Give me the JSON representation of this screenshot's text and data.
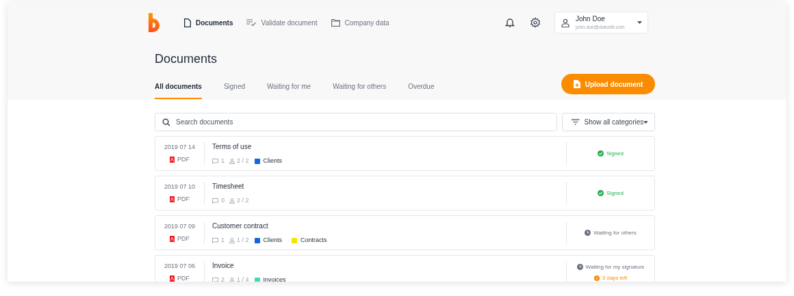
{
  "nav": {
    "items": [
      {
        "label": "Documents",
        "kind": "file",
        "selected": true
      },
      {
        "label": "Validate document",
        "kind": "checklist",
        "selected": false
      },
      {
        "label": "Company data",
        "kind": "folder",
        "selected": false
      }
    ]
  },
  "user": {
    "name": "John Doe",
    "email": "john.doe@dokobit.com"
  },
  "page_title": "Documents",
  "tabs": [
    {
      "label": "All documents",
      "selected": true
    },
    {
      "label": "Signed",
      "selected": false
    },
    {
      "label": "Waiting for me",
      "selected": false
    },
    {
      "label": "Waiting for others",
      "selected": false
    },
    {
      "label": "Overdue",
      "selected": false
    }
  ],
  "upload_button": "Upload document",
  "search": {
    "placeholder": "Search documents"
  },
  "filter": "Show all categories",
  "documents": [
    {
      "date": "2019 07 14",
      "type": "PDF",
      "title": "Terms of use",
      "comments": "1",
      "signers": "2 / 2",
      "tags": [
        {
          "label": "Clients",
          "color": "#1565e0"
        }
      ],
      "status": {
        "kind": "signed",
        "label": "Signed"
      }
    },
    {
      "date": "2019 07 10",
      "type": "PDF",
      "title": "Timesheet",
      "comments": "0",
      "signers": "2 / 2",
      "status": {
        "kind": "signed",
        "label": "Signed"
      }
    },
    {
      "date": "2019 07 09",
      "type": "PDF",
      "title": "Customer contract",
      "comments": "1",
      "signers": "1 / 2",
      "tags": [
        {
          "label": "Clients",
          "color": "#1565e0"
        },
        {
          "label": "Contracts",
          "color": "#f5e600"
        }
      ],
      "status": {
        "kind": "waiting",
        "label": "Waiting for others"
      }
    },
    {
      "date": "2019 07 06",
      "type": "PDF",
      "title": "Invoice",
      "comments": "2",
      "signers": "1 / 4",
      "tags": [
        {
          "label": "Invoices",
          "color": "#3ddbb8"
        }
      ],
      "status": {
        "kind": "waiting",
        "label": "Waiting for my signature",
        "note": "3 days left"
      }
    }
  ]
}
